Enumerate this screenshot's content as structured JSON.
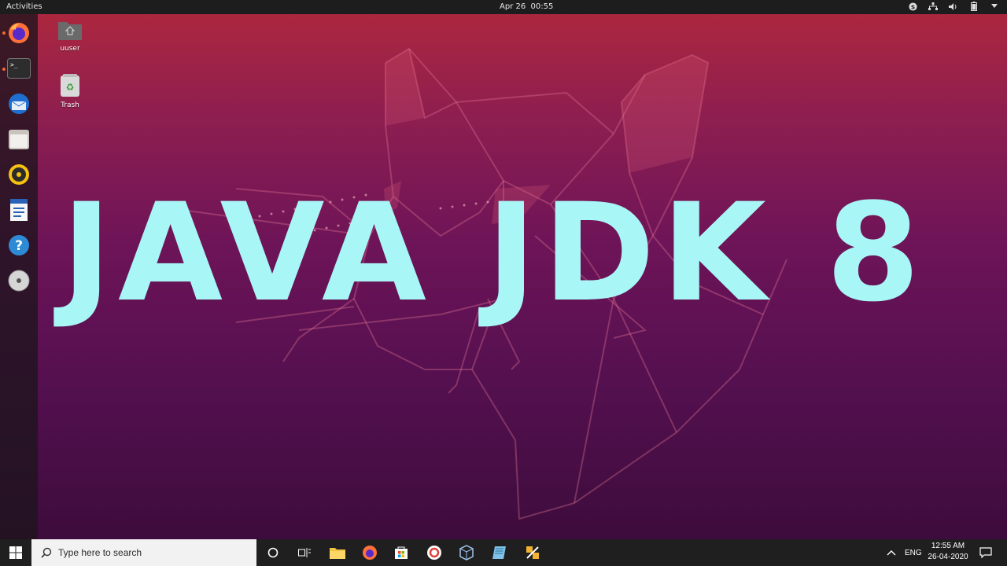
{
  "topbar": {
    "activities": "Activities",
    "datetime": "Apr 26  00:55",
    "tray_icons": [
      "skype-icon",
      "network-icon",
      "volume-icon",
      "battery-icon",
      "menu-arrow-icon"
    ]
  },
  "dock": {
    "items": [
      {
        "name": "firefox",
        "icon": "firefox-icon",
        "running": true
      },
      {
        "name": "terminal",
        "icon": "terminal-icon",
        "running": true
      },
      {
        "name": "thunderbird",
        "icon": "thunderbird-icon",
        "running": false
      },
      {
        "name": "files",
        "icon": "files-icon",
        "running": false
      },
      {
        "name": "rhythmbox",
        "icon": "rhythmbox-icon",
        "running": false
      },
      {
        "name": "writer",
        "icon": "writer-icon",
        "running": false
      },
      {
        "name": "help",
        "icon": "help-icon",
        "running": false
      },
      {
        "name": "dvd",
        "icon": "dvd-icon",
        "running": false
      }
    ]
  },
  "desktop": {
    "icons": [
      {
        "label": "uuser",
        "icon": "home-folder-icon"
      },
      {
        "label": "Trash",
        "icon": "trash-icon"
      }
    ],
    "headline": "JAVA JDK 8"
  },
  "taskbar": {
    "search_placeholder": "Type here to search",
    "apps": [
      "cortana-icon",
      "task-view-icon",
      "file-explorer-icon",
      "firefox-icon",
      "store-icon",
      "app-icon",
      "virtualbox-icon",
      "notepad-icon",
      "tools-icon"
    ],
    "language": "ENG",
    "time": "12:55 AM",
    "date": "26-04-2020"
  },
  "colors": {
    "headline": "#a8f7f6",
    "wallpaper_top": "#b0283c",
    "wallpaper_bottom": "#3d0c3c",
    "taskbar": "#1f1f1f"
  }
}
